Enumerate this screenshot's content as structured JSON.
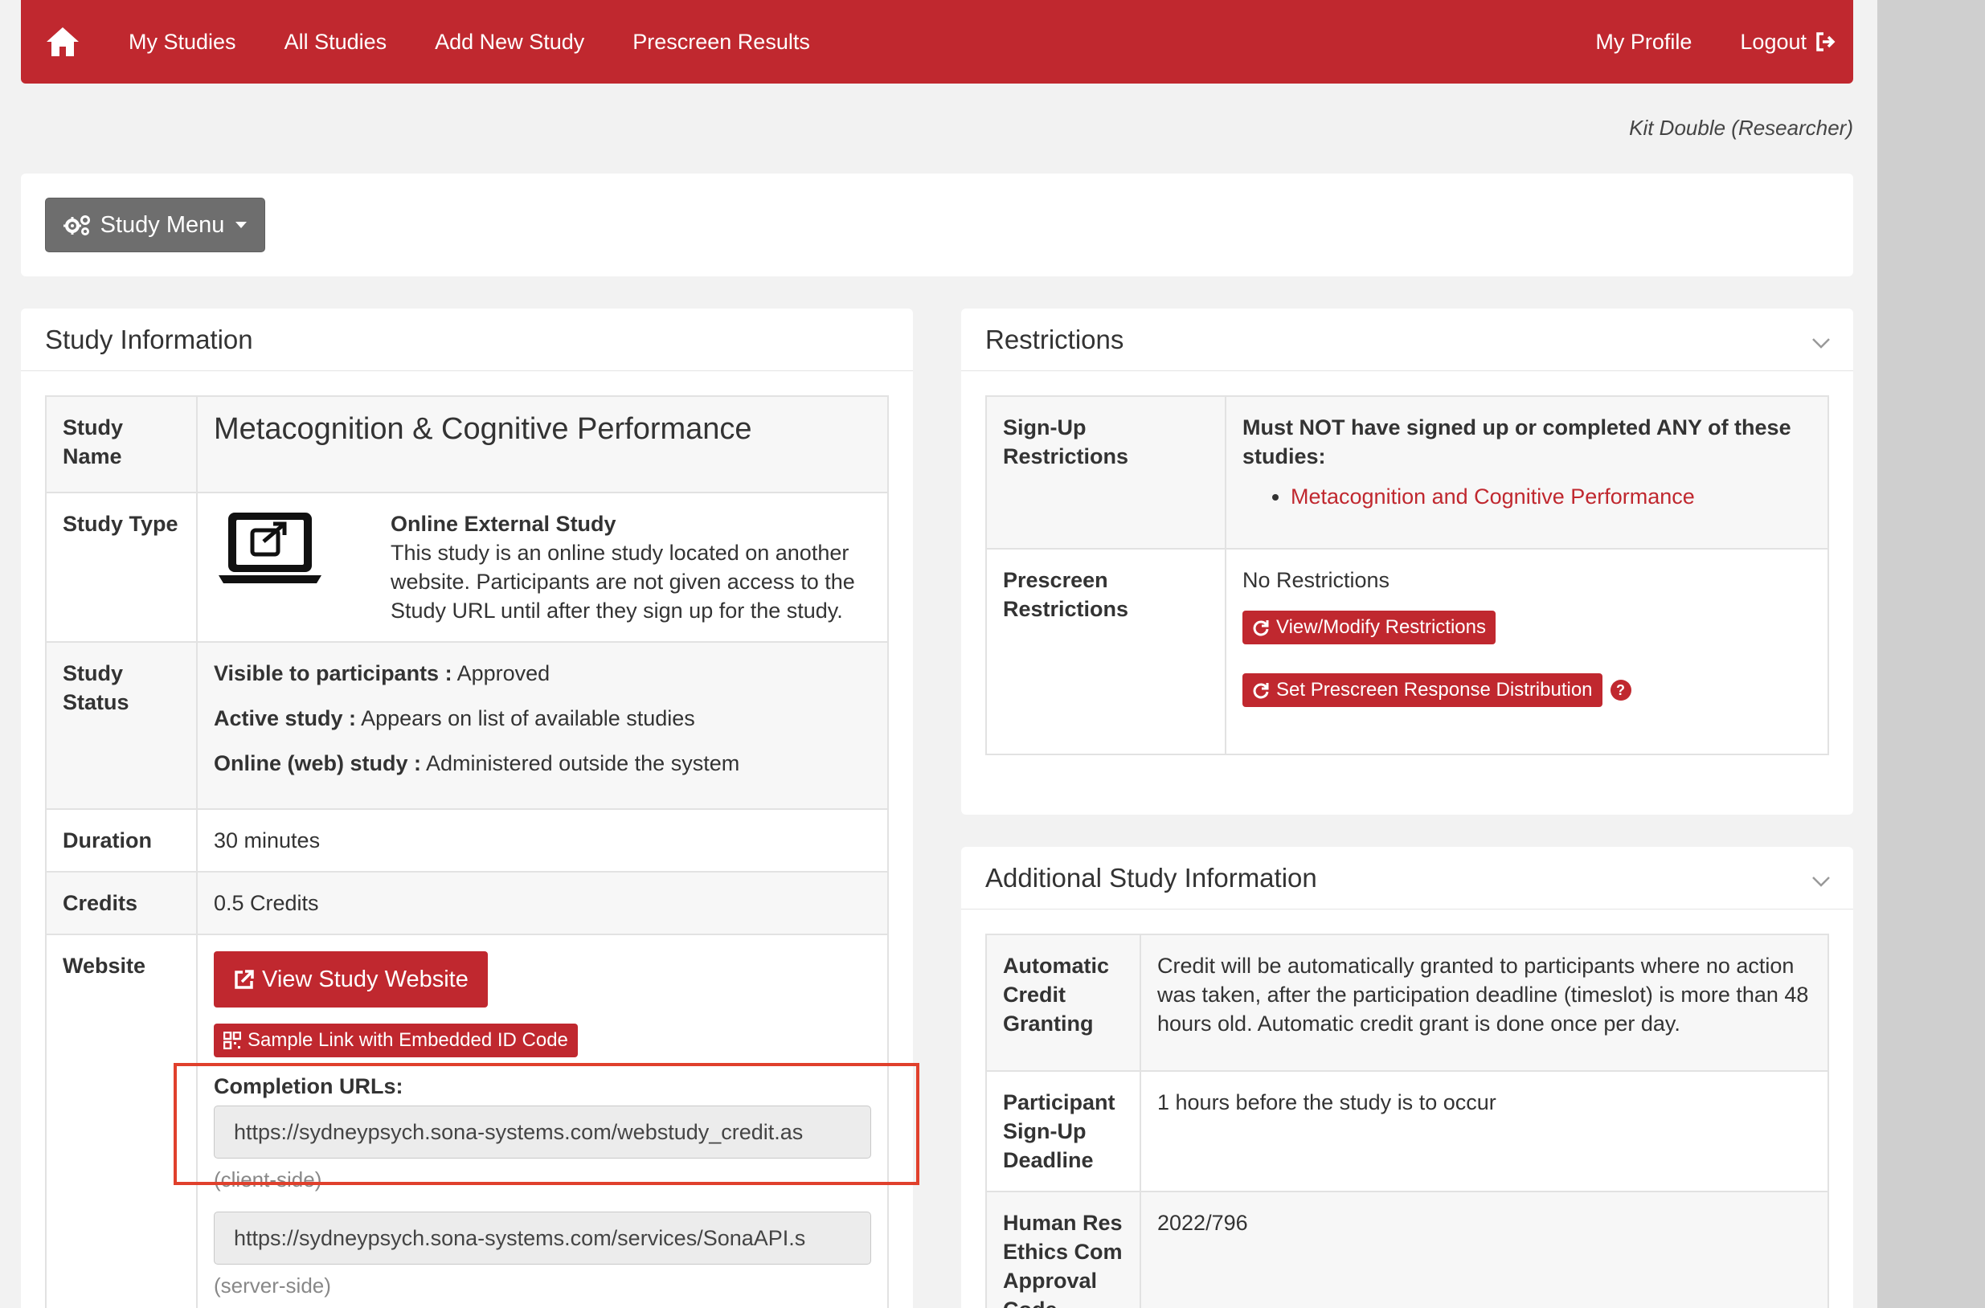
{
  "nav": {
    "items": [
      "My Studies",
      "All Studies",
      "Add New Study",
      "Prescreen Results"
    ],
    "my_profile": "My Profile",
    "logout": "Logout"
  },
  "user": "Kit Double (Researcher)",
  "study_menu_label": "Study Menu",
  "study_info": {
    "heading": "Study Information",
    "name_label": "Study Name",
    "name_value": "Metacognition & Cognitive Performance",
    "type_label": "Study Type",
    "type_title": "Online External Study",
    "type_desc": "This study is an online study located on another website. Participants are not given access to the Study URL until after they sign up for the study.",
    "status_label": "Study Status",
    "status_lines": [
      {
        "key": "Visible to participants :",
        "value": "Approved"
      },
      {
        "key": "Active study :",
        "value": "Appears on list of available studies"
      },
      {
        "key": "Online (web) study :",
        "value": "Administered outside the system"
      }
    ],
    "duration_label": "Duration",
    "duration_value": "30 minutes",
    "credits_label": "Credits",
    "credits_value": "0.5 Credits",
    "website_label": "Website",
    "view_website_btn": "View Study Website",
    "sample_link_btn": "Sample Link with Embedded ID Code",
    "completion_label": "Completion URLs:",
    "client_url": "https://sydneypsych.sona-systems.com/webstudy_credit.as",
    "client_note": "(client-side)",
    "server_url": "https://sydneypsych.sona-systems.com/services/SonaAPI.s",
    "server_note": "(server-side)"
  },
  "restrictions": {
    "heading": "Restrictions",
    "signup_label": "Sign-Up Restrictions",
    "signup_text": "Must NOT have signed up or completed ANY of these studies:",
    "signup_studies": [
      "Metacognition and Cognitive Performance"
    ],
    "prescreen_label": "Prescreen Restrictions",
    "prescreen_value": "No Restrictions",
    "view_modify_btn": "View/Modify Restrictions",
    "set_prescreen_btn": "Set Prescreen Response Distribution",
    "help": "?"
  },
  "additional": {
    "heading": "Additional Study Information",
    "rows": [
      {
        "label": "Automatic Credit Granting",
        "value": "Credit will be automatically granted to participants where no action was taken, after the participation deadline (timeslot) is more than 48 hours old. Automatic credit grant is done once per day."
      },
      {
        "label": "Participant Sign-Up Deadline",
        "value": "1 hours before the study is to occur"
      },
      {
        "label": "Human Res Ethics Com Approval Code",
        "value": "2022/796"
      }
    ]
  },
  "colors": {
    "brand_red": "#c0282f",
    "highlight": "#e0402c",
    "gray_button": "#6e6e6e"
  }
}
